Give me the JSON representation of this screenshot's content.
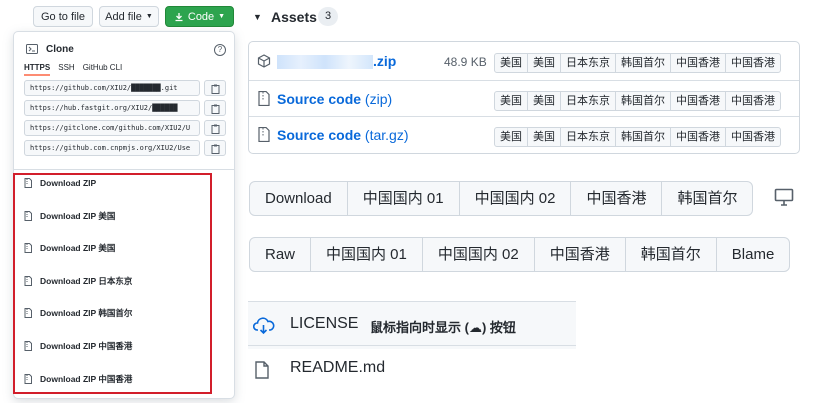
{
  "toolbar": {
    "goto_file": "Go to file",
    "add_file": "Add file",
    "code": "Code"
  },
  "clone": {
    "title": "Clone",
    "tabs": [
      "HTTPS",
      "SSH",
      "GitHub CLI"
    ],
    "urls": [
      "https://github.com/XIU2/███████.git",
      "https://hub.fastgit.org/XIU2/██████",
      "https://gitclone.com/github.com/XIU2/U",
      "https://github.com.cnpmjs.org/XIU2/Use"
    ],
    "downloads": [
      "Download ZIP",
      "Download ZIP 美国",
      "Download ZIP 美国",
      "Download ZIP 日本东京",
      "Download ZIP 韩国首尔",
      "Download ZIP 中国香港",
      "Download ZIP 中国香港"
    ]
  },
  "assets": {
    "title": "Assets",
    "count": "3",
    "rows": [
      {
        "name": "",
        "ext": ".zip",
        "size": "48.9 KB"
      },
      {
        "name": "Source code",
        "ext": "(zip)",
        "size": ""
      },
      {
        "name": "Source code",
        "ext": "(tar.gz)",
        "size": ""
      }
    ],
    "mirrors": [
      "美国",
      "美国",
      "日本东京",
      "韩国首尔",
      "中国香港",
      "中国香港"
    ]
  },
  "file_buttons": {
    "download": [
      "Download",
      "中国国内 01",
      "中国国内 02",
      "中国香港",
      "韩国首尔"
    ],
    "raw": [
      "Raw",
      "中国国内 01",
      "中国国内 02",
      "中国香港",
      "韩国首尔",
      "Blame"
    ]
  },
  "files": [
    {
      "name": "LICENSE",
      "hint": "鼠标指向时显示 (☁) 按钮"
    },
    {
      "name": "README.md",
      "hint": ""
    }
  ],
  "colors": {
    "accent": "#0969da",
    "green": "#2da44e",
    "highlight_frame": "#d21e2b"
  }
}
